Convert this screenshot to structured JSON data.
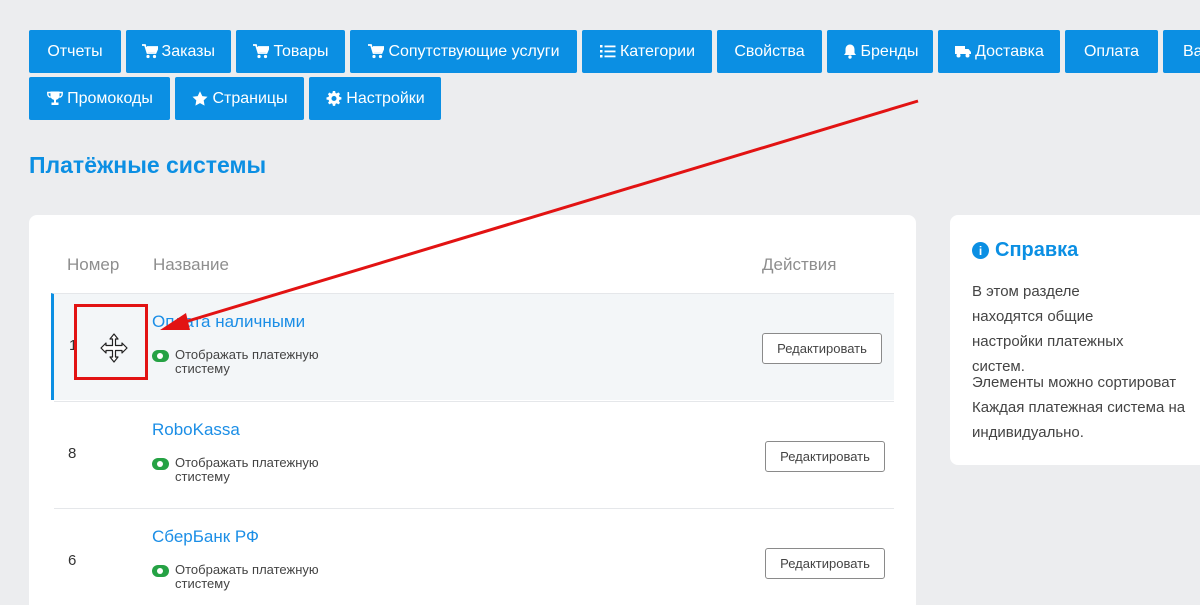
{
  "nav": {
    "row1": [
      {
        "label": "Отчеты",
        "icon": ""
      },
      {
        "label": "Заказы",
        "icon": "cart-icon"
      },
      {
        "label": "Товары",
        "icon": "cart-icon"
      },
      {
        "label": "Сопутствующие услуги",
        "icon": "cart-plus-icon"
      },
      {
        "label": "Категории",
        "icon": "list-icon"
      },
      {
        "label": "Свойства",
        "icon": ""
      },
      {
        "label": "Бренды",
        "icon": "bell-icon"
      },
      {
        "label": "Доставка",
        "icon": "truck-icon"
      },
      {
        "label": "Оплата",
        "icon": ""
      },
      {
        "label": "Ва",
        "icon": ""
      }
    ],
    "row2": [
      {
        "label": "Промокоды",
        "icon": "trophy-icon"
      },
      {
        "label": "Страницы",
        "icon": "star-icon"
      },
      {
        "label": "Настройки",
        "icon": "gear-icon"
      }
    ]
  },
  "page": {
    "title": "Платёжные системы"
  },
  "table": {
    "headers": {
      "num": "Номер",
      "name": "Название",
      "actions": "Действия"
    },
    "rows": [
      {
        "num": "1",
        "name": "Оплата наличными",
        "toggle_label": "Отображать платежную стистему",
        "edit_label": "Редактировать"
      },
      {
        "num": "8",
        "name": "RoboKassa",
        "toggle_label": "Отображать платежную стистему",
        "edit_label": "Редактировать"
      },
      {
        "num": "6",
        "name": "СберБанк РФ",
        "toggle_label": "Отображать платежную стистему",
        "edit_label": "Редактировать"
      }
    ]
  },
  "help": {
    "title": "Справка",
    "p1": "В этом разделе находятся общие настройки платежных систем.",
    "p2_line1": "Элементы можно сортироват",
    "p2_line2": "Каждая платежная система на",
    "p2_line3": "индивидуально."
  },
  "colors": {
    "accent": "#0b8fe3",
    "toggle_on": "#25a244",
    "annotation": "#e21313"
  }
}
